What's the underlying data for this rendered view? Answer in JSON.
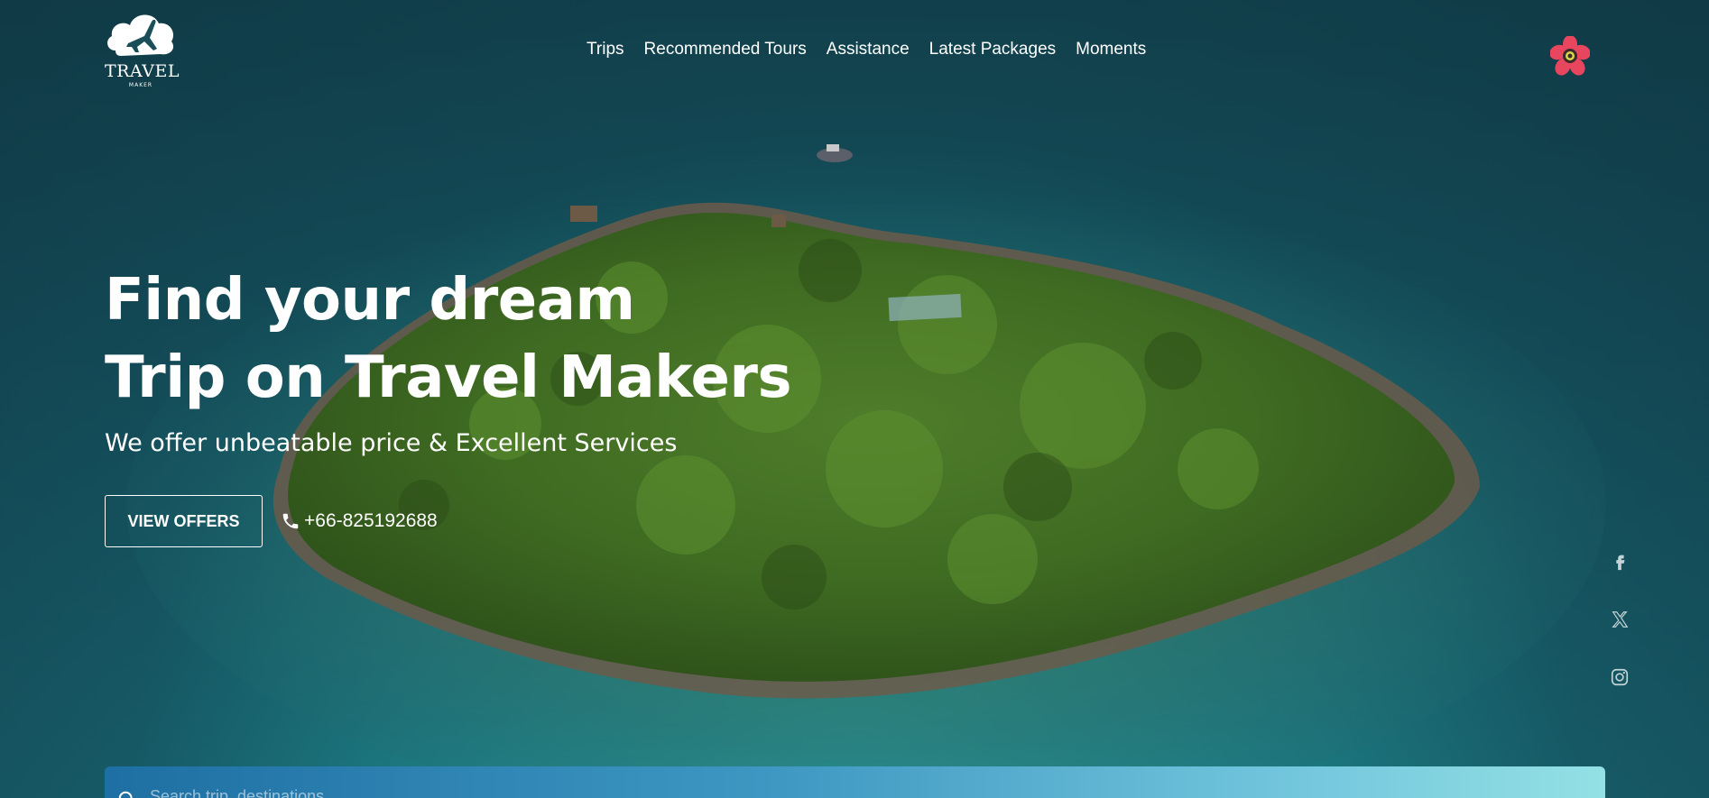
{
  "brand": {
    "name": "TRAVEL",
    "tagline": "MAKER"
  },
  "nav": {
    "items": [
      {
        "label": "Trips"
      },
      {
        "label": "Recommended Tours"
      },
      {
        "label": "Assistance"
      },
      {
        "label": "Latest Packages"
      },
      {
        "label": "Moments"
      }
    ]
  },
  "hero": {
    "headline_line1": "Find your dream",
    "headline_line2": "Trip on Travel Makers",
    "subline": "We offer unbeatable price & Excellent Services",
    "offers_label": "VIEW OFFERS",
    "phone": "+66-825192688"
  },
  "search": {
    "placeholder": "Search trip, destinations"
  },
  "icons": {
    "profile": "flower-avatar-icon",
    "phone": "phone-icon",
    "search": "search-icon",
    "socials": [
      "facebook-icon",
      "x-twitter-icon",
      "instagram-icon"
    ]
  },
  "colors": {
    "accent_profile": "#e8455f",
    "search_gradient_start": "#1e6fa3",
    "search_gradient_end": "#93e1e4"
  }
}
